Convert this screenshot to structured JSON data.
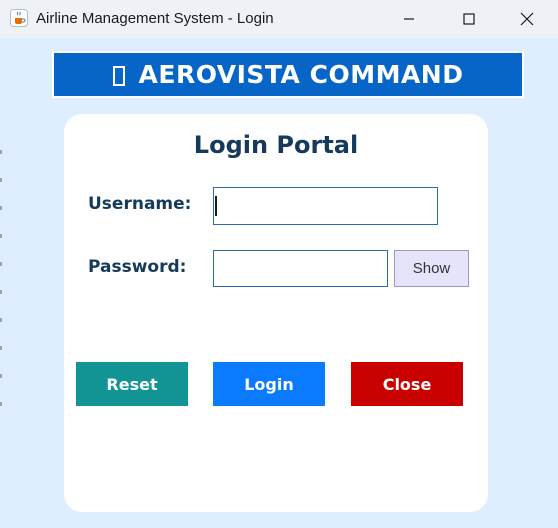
{
  "window": {
    "title": "Airline Management System - Login"
  },
  "banner": {
    "text": "AEROVISTA COMMAND",
    "glyph": "missing-glyph-icon",
    "color": "#0765c8"
  },
  "card": {
    "title": "Login Portal",
    "username_label": "Username:",
    "password_label": "Password:",
    "username_value": "",
    "password_value": "",
    "show_label": "Show"
  },
  "actions": {
    "reset_label": "Reset",
    "login_label": "Login",
    "close_label": "Close",
    "reset_color": "#129494",
    "login_color": "#0a7bff",
    "close_color": "#c80000"
  },
  "icons": {
    "app": "java-cup-icon",
    "minimize": "minimize-icon",
    "maximize": "maximize-icon",
    "close": "close-icon"
  }
}
